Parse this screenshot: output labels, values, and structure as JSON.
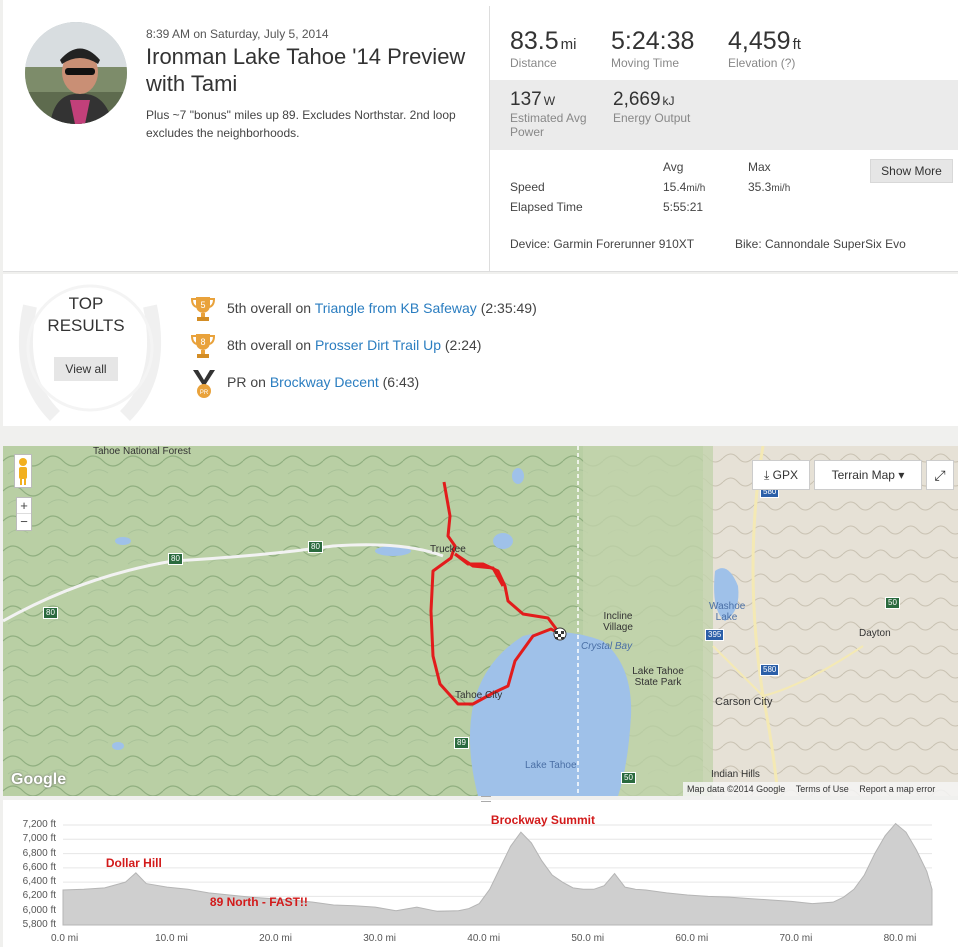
{
  "activity": {
    "datetime": "8:39 AM on Saturday, July 5, 2014",
    "title": "Ironman Lake Tahoe '14 Preview with Tami",
    "description": "Plus ~7 \"bonus\" miles up 89. Excludes Northstar. 2nd loop excludes the neighborhoods."
  },
  "stats": {
    "distance": {
      "value": "83.5",
      "unit": "mi",
      "label": "Distance"
    },
    "moving_time": {
      "value": "5:24:38",
      "label": "Moving Time"
    },
    "elevation": {
      "value": "4,459",
      "unit": "ft",
      "label": "Elevation (?)"
    },
    "power": {
      "value": "137",
      "unit": "W",
      "label": "Estimated Avg Power"
    },
    "energy": {
      "value": "2,669",
      "unit": "kJ",
      "label": "Energy Output"
    }
  },
  "table": {
    "avg_header": "Avg",
    "max_header": "Max",
    "speed_label": "Speed",
    "speed_avg": "15.4",
    "speed_avg_unit": "mi/h",
    "speed_max": "35.3",
    "speed_max_unit": "mi/h",
    "elapsed_label": "Elapsed Time",
    "elapsed_avg": "5:55:21",
    "show_more": "Show More"
  },
  "device": "Device: Garmin Forerunner 910XT",
  "bike": "Bike: Cannondale SuperSix Evo",
  "top_results": {
    "heading_line1": "TOP",
    "heading_line2": "RESULTS",
    "view_all": "View all",
    "items": [
      {
        "badge": "5",
        "rank": "5th overall",
        "on": "on",
        "segment": "Triangle from KB Safeway",
        "time": "(2:35:49)"
      },
      {
        "badge": "8",
        "rank": "8th overall",
        "on": "on",
        "segment": "Prosser Dirt Trail Up",
        "time": "(2:24)"
      },
      {
        "badge": "PR",
        "rank": "PR",
        "on": "on",
        "segment": "Brockway Decent",
        "time": "(6:43)"
      }
    ]
  },
  "map": {
    "gpx": "GPX",
    "map_type": "Terrain Map",
    "labels": {
      "tahoe_nf": "Tahoe National Forest",
      "truckee": "Truckee",
      "incline": "Incline Village",
      "crystal": "Crystal Bay",
      "state_park": "Lake Tahoe State Park",
      "tahoe_city": "Tahoe City",
      "lake": "Lake Tahoe",
      "washoe": "Washoe Lake",
      "dayton": "Dayton",
      "carson": "Carson City",
      "indian": "Indian Hills"
    },
    "shields": [
      "80",
      "80",
      "80",
      "89",
      "50",
      "580",
      "395",
      "580",
      "50"
    ],
    "footer_data": "Map data ©2014 Google",
    "footer_terms": "Terms of Use",
    "footer_report": "Report a map error",
    "google": "Google",
    "zoom_in": "+",
    "zoom_out": "−"
  },
  "chart_data": {
    "type": "area",
    "y_ticks": [
      "7,200 ft",
      "7,000 ft",
      "6,800 ft",
      "6,600 ft",
      "6,400 ft",
      "6,200 ft",
      "6,000 ft",
      "5,800 ft"
    ],
    "x_ticks": [
      "0.0 mi",
      "10.0 mi",
      "20.0 mi",
      "30.0 mi",
      "40.0 mi",
      "50.0 mi",
      "60.0 mi",
      "70.0 mi",
      "80.0 mi"
    ],
    "ylim": [
      5800,
      7200
    ],
    "xlim": [
      0,
      83.5
    ],
    "x": [
      0,
      2,
      4,
      6,
      7,
      8,
      10,
      12,
      14,
      16,
      18,
      20,
      22,
      24,
      26,
      28,
      30,
      32,
      34,
      36,
      38,
      39,
      40,
      41,
      42,
      43,
      44,
      45,
      46,
      47,
      48,
      49,
      50,
      51,
      52,
      53,
      54,
      55,
      56,
      58,
      60,
      62,
      64,
      66,
      68,
      70,
      72,
      74,
      75,
      76,
      77,
      78,
      79,
      80,
      81,
      82,
      83,
      83.5
    ],
    "y": [
      6290,
      6300,
      6320,
      6400,
      6530,
      6380,
      6330,
      6300,
      6250,
      6220,
      6190,
      6170,
      6150,
      6120,
      6080,
      6070,
      6050,
      6000,
      6050,
      5990,
      6000,
      6030,
      6100,
      6300,
      6600,
      6900,
      7100,
      6950,
      6700,
      6500,
      6400,
      6320,
      6300,
      6300,
      6350,
      6520,
      6330,
      6300,
      6290,
      6250,
      6220,
      6200,
      6190,
      6170,
      6150,
      6130,
      6100,
      6120,
      6190,
      6300,
      6500,
      6800,
      7050,
      7220,
      7100,
      6850,
      6550,
      6300
    ],
    "annotations": [
      {
        "text": "Dollar Hill",
        "x": 7,
        "y": 6650
      },
      {
        "text": "89 North - FAST!!",
        "x": 17,
        "y": 6110
      },
      {
        "text": "Brockway Summit",
        "x": 44,
        "y": 7250
      }
    ]
  }
}
